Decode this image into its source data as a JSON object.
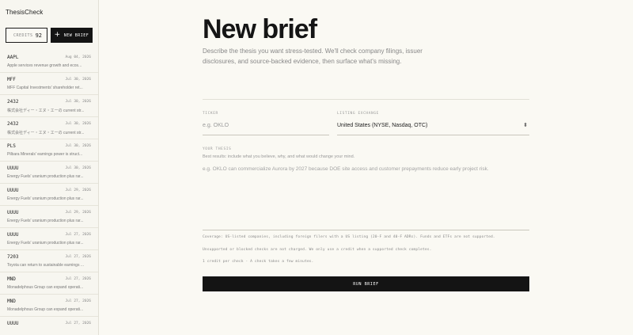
{
  "brand": "ThesisCheck",
  "credits": {
    "label": "CREDITS",
    "value": "92"
  },
  "new_brief_button": {
    "icon": "+",
    "label": "NEW BRIEF"
  },
  "briefs": [
    {
      "ticker": "AAPL",
      "date": "Aug 04, 2026",
      "summary": "Apple services revenue growth and ecos..."
    },
    {
      "ticker": "MFF",
      "date": "Jul 30, 2026",
      "summary": "MFF Capital Investments' shareholder ret..."
    },
    {
      "ticker": "2432",
      "date": "Jul 30, 2026",
      "summary": "株式会社ディー・エヌ・エーの current str..."
    },
    {
      "ticker": "2432",
      "date": "Jul 30, 2026",
      "summary": "株式会社ディー・エヌ・エーの current str..."
    },
    {
      "ticker": "PLS",
      "date": "Jul 30, 2026",
      "summary": "Pilbara Minerals' earnings power is struct..."
    },
    {
      "ticker": "UUUU",
      "date": "Jul 30, 2026",
      "summary": "Energy Fuels' uranium production plus rar..."
    },
    {
      "ticker": "UUUU",
      "date": "Jul 29, 2026",
      "summary": "Energy Fuels' uranium production plus rar..."
    },
    {
      "ticker": "UUUU",
      "date": "Jul 29, 2026",
      "summary": "Energy Fuels' uranium production plus rar..."
    },
    {
      "ticker": "UUUU",
      "date": "Jul 27, 2026",
      "summary": "Energy Fuels' uranium production plus rar..."
    },
    {
      "ticker": "7203",
      "date": "Jul 27, 2026",
      "summary": "Toyota can return to sustainable earnings ..."
    },
    {
      "ticker": "MND",
      "date": "Jul 27, 2026",
      "summary": "Monadelphous Group can expand operati..."
    },
    {
      "ticker": "MND",
      "date": "Jul 27, 2026",
      "summary": "Monadelphous Group can expand operati..."
    },
    {
      "ticker": "UUUU",
      "date": "Jul 27, 2026",
      "summary": ""
    }
  ],
  "main": {
    "title": "New brief",
    "description": "Describe the thesis you want stress-tested. We'll check company filings, issuer disclosures, and source-backed evidence, then surface what's missing.",
    "ticker_label": "TICKER",
    "ticker_placeholder": "e.g. OKLO",
    "exchange_label": "LISTING EXCHANGE",
    "exchange_value": "United States (NYSE, Nasdaq, OTC)",
    "thesis_label": "YOUR THESIS",
    "thesis_hint": "Best results: include what you believe, why, and what would change your mind.",
    "thesis_placeholder": "e.g. OKLO can commercialize Aurora by 2027 because DOE site access and customer prepayments reduce early project risk.",
    "coverage_note": "Coverage: US-listed companies, including foreign filers with a US listing (20-F and 40-F ADRs). Funds and ETFs are not supported.",
    "credit_note": "Unsupported or blocked checks are not charged. We only use a credit when a supported check completes.",
    "time_note": "1 credit per check · A check takes a few minutes.",
    "run_button": "RUN BRIEF"
  }
}
